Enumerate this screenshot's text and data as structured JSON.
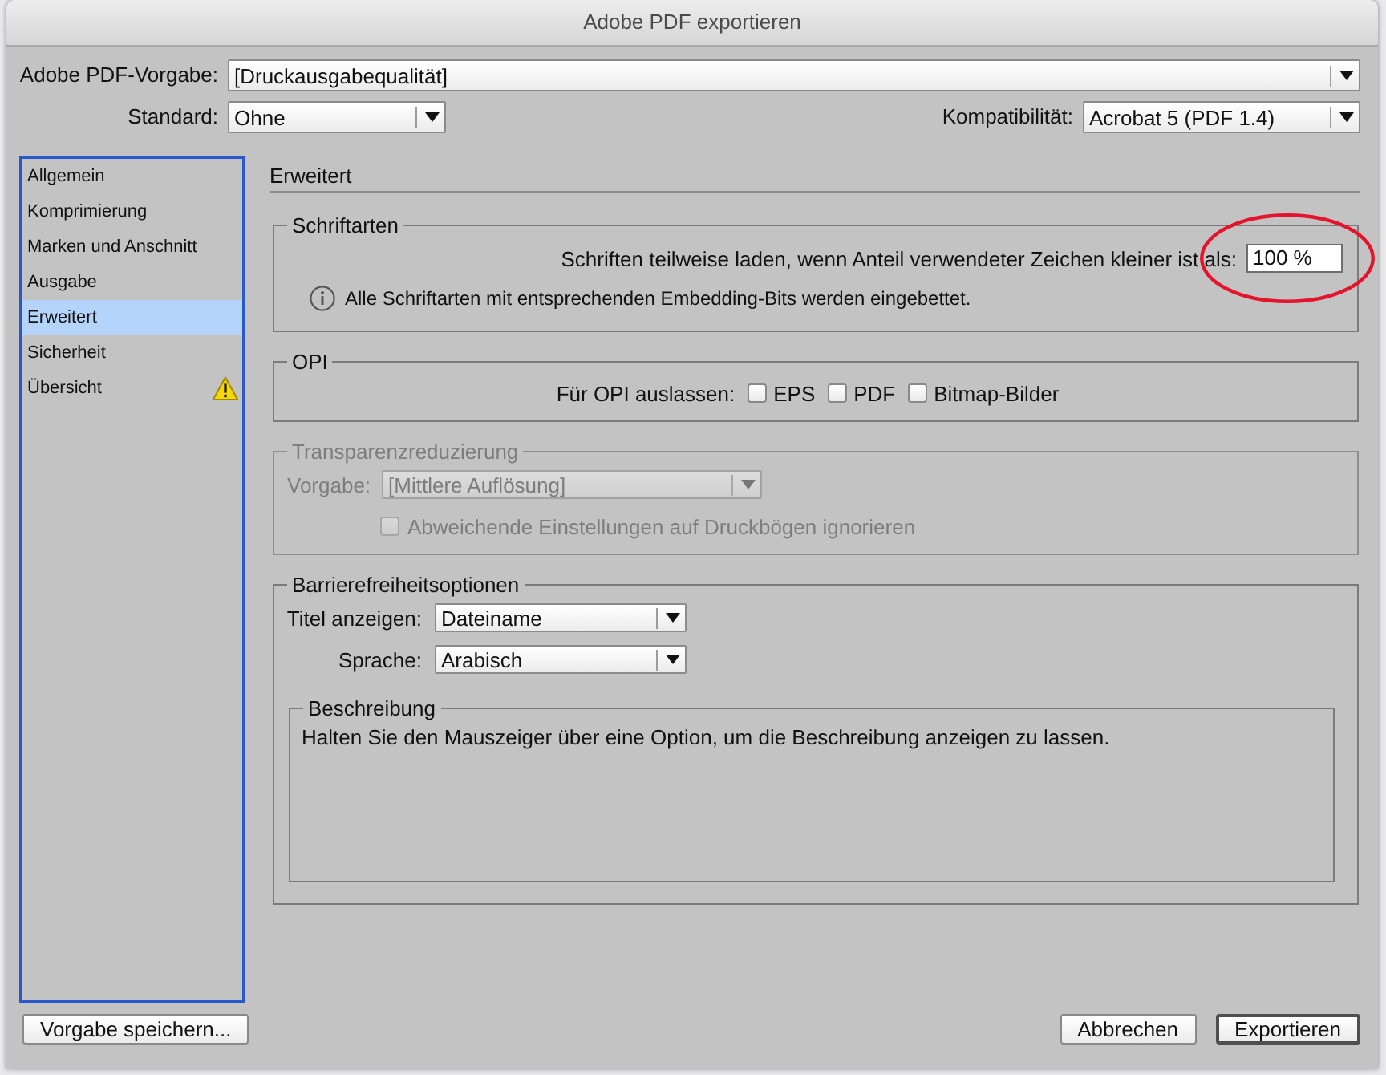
{
  "window": {
    "title": "Adobe PDF exportieren"
  },
  "header": {
    "preset": {
      "label": "Adobe PDF-Vorgabe:",
      "value": "[Druckausgabequalität]"
    },
    "standard": {
      "label": "Standard:",
      "value": "Ohne"
    },
    "compatibility": {
      "label": "Kompatibilität:",
      "value": "Acrobat 5 (PDF 1.4)"
    }
  },
  "sidebar": {
    "items": [
      {
        "label": "Allgemein",
        "selected": false,
        "warning": false
      },
      {
        "label": "Komprimierung",
        "selected": false,
        "warning": false
      },
      {
        "label": "Marken und Anschnitt",
        "selected": false,
        "warning": false
      },
      {
        "label": "Ausgabe",
        "selected": false,
        "warning": false
      },
      {
        "label": "Erweitert",
        "selected": true,
        "warning": false
      },
      {
        "label": "Sicherheit",
        "selected": false,
        "warning": false
      },
      {
        "label": "Übersicht",
        "selected": false,
        "warning": true
      }
    ]
  },
  "panel": {
    "title": "Erweitert",
    "groups": [
      {
        "kind": "fonts",
        "title": "Schriftarten",
        "disabled": false,
        "subset": {
          "label": "Schriften teilweise laden, wenn Anteil verwendeter Zeichen kleiner ist als:",
          "value": "100 %",
          "circled": true
        },
        "note": "Alle Schriftarten mit entsprechenden Embedding-Bits werden eingebettet."
      },
      {
        "kind": "opi",
        "title": "OPI",
        "disabled": false,
        "label": "Für OPI auslassen:",
        "options": [
          {
            "label": "EPS",
            "checked": false
          },
          {
            "label": "PDF",
            "checked": false
          },
          {
            "label": "Bitmap-Bilder",
            "checked": false
          }
        ]
      },
      {
        "kind": "transparency",
        "title": "Transparenzreduzierung",
        "disabled": true,
        "preset": {
          "label": "Vorgabe:",
          "value": "[Mittlere Auflösung]"
        },
        "option": {
          "label": "Abweichende Einstellungen auf Druckbögen ignorieren",
          "checked": false
        }
      },
      {
        "kind": "accessibility",
        "title": "Barrierefreiheitsoptionen",
        "disabled": false,
        "fields": [
          {
            "label": "Titel anzeigen:",
            "value": "Dateiname"
          },
          {
            "label": "Sprache:",
            "value": "Arabisch"
          }
        ],
        "description": {
          "title": "Beschreibung",
          "text": "Halten Sie den Mauszeiger über eine Option, um die Beschreibung anzeigen zu lassen."
        }
      }
    ]
  },
  "footer": {
    "left_buttons": [
      {
        "label": "Vorgabe speichern...",
        "default": false
      }
    ],
    "right_buttons": [
      {
        "label": "Abbrechen",
        "default": false
      },
      {
        "label": "Exportieren",
        "default": true
      }
    ]
  }
}
